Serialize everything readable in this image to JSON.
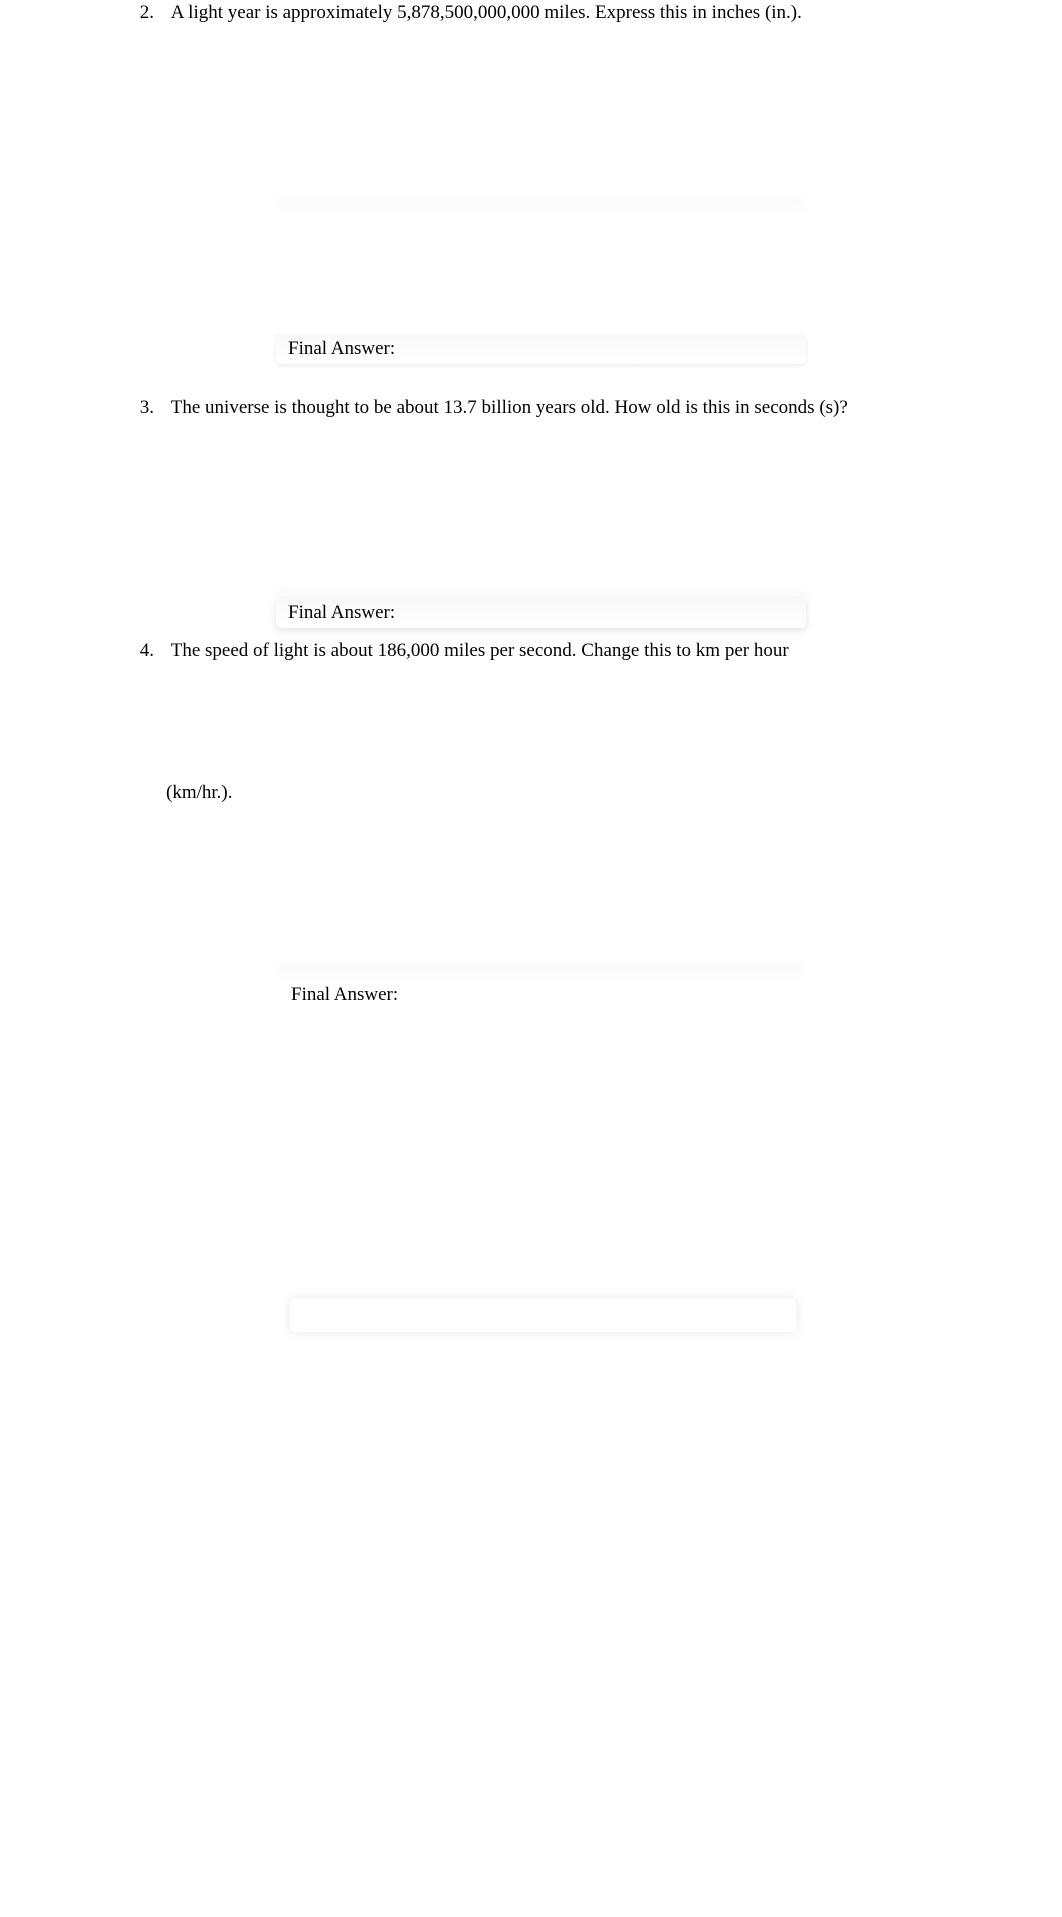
{
  "questions": [
    {
      "number": "2.",
      "text": "A light year is approximately 5,878,500,000,000 miles. Express this in inches (in.).",
      "final_answer_label": "Final Answer:"
    },
    {
      "number": "3.",
      "text": "The universe is thought to be about 13.7 billion years old. How old is this in seconds (s)?",
      "final_answer_label": "Final Answer:"
    },
    {
      "number": "4.",
      "text": "The speed of light is about 186,000 miles per second. Change this to km per hour",
      "continuation": "(km/hr.).",
      "final_answer_label": "Final Answer:"
    }
  ]
}
